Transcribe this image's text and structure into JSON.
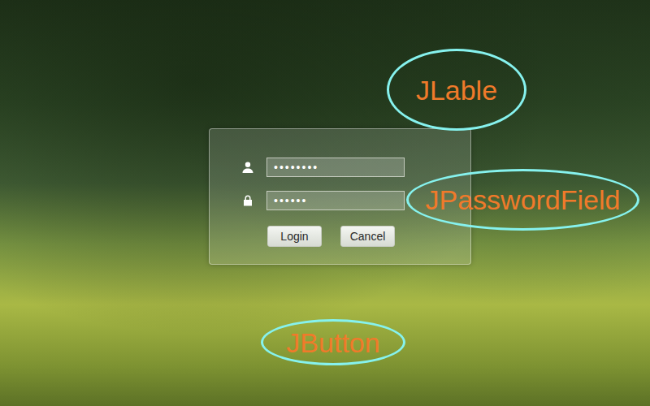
{
  "login_panel": {
    "fields": [
      {
        "kind": "user",
        "value": "••••••••"
      },
      {
        "kind": "password",
        "value": "••••••"
      }
    ],
    "buttons": [
      {
        "label": "Login"
      },
      {
        "label": "Cancel"
      }
    ]
  },
  "annotations": [
    {
      "label": "JLable"
    },
    {
      "label": "JPasswordField"
    },
    {
      "label": "JButton"
    }
  ]
}
